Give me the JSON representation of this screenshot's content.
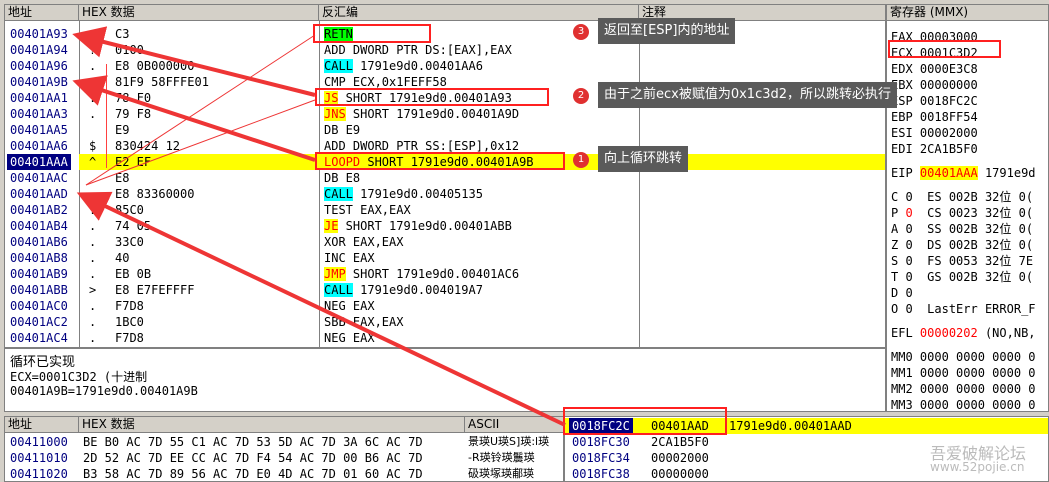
{
  "disasm": {
    "headers": {
      "addr": "地址",
      "hex": "HEX 数据",
      "asm": "反汇编",
      "comment": "注释"
    },
    "rows": [
      {
        "addr": "00401A93",
        "mark": ">",
        "hex": "C3",
        "asm": "RETN",
        "kw": "RETN",
        "kwstyle": "g",
        "rest": ""
      },
      {
        "addr": "00401A94",
        "mark": "?",
        "hex": "0100",
        "asm": "ADD DWORD PTR DS:[EAX],EAX",
        "kw": "",
        "kwstyle": "",
        "rest": ""
      },
      {
        "addr": "00401A96",
        "mark": ".",
        "hex": "E8 0B000000",
        "asm": "",
        "kw": "CALL",
        "kwstyle": "c",
        "rest": " 1791e9d0.00401AA6"
      },
      {
        "addr": "00401A9B",
        "mark": ".",
        "hex": "81F9 58FFFE01",
        "asm": "CMP ECX,0x1FEFF58",
        "kw": "",
        "kwstyle": "",
        "rest": ""
      },
      {
        "addr": "00401AA1",
        "mark": ".",
        "hex": "78 F0",
        "asm": "",
        "kw": "JS",
        "kwstyle": "y",
        "rest": " SHORT 1791e9d0.00401A93"
      },
      {
        "addr": "00401AA3",
        "mark": ".",
        "hex": "79 F8",
        "asm": "",
        "kw": "JNS",
        "kwstyle": "y",
        "rest": " SHORT 1791e9d0.00401A9D"
      },
      {
        "addr": "00401AA5",
        "mark": "",
        "hex": "E9",
        "asm": "DB E9",
        "kw": "",
        "kwstyle": "",
        "rest": ""
      },
      {
        "addr": "00401AA6",
        "mark": "$",
        "hex": "830424 12",
        "asm": "ADD DWORD PTR SS:[ESP],0x12",
        "kw": "",
        "kwstyle": "",
        "rest": ""
      },
      {
        "addr": "00401AAA",
        "mark": "^",
        "hex": "E2 EF",
        "asm": "",
        "kw": "LOOPD",
        "kwstyle": "y",
        "rest": " SHORT 1791e9d0.00401A9B"
      },
      {
        "addr": "00401AAC",
        "mark": "",
        "hex": "E8",
        "asm": "DB E8",
        "kw": "",
        "kwstyle": "",
        "rest": ""
      },
      {
        "addr": "00401AAD",
        "mark": ".",
        "hex": "E8 83360000",
        "asm": "",
        "kw": "CALL",
        "kwstyle": "c",
        "rest": " 1791e9d0.00405135"
      },
      {
        "addr": "00401AB2",
        "mark": ".",
        "hex": "85C0",
        "asm": "TEST EAX,EAX",
        "kw": "",
        "kwstyle": "",
        "rest": ""
      },
      {
        "addr": "00401AB4",
        "mark": ".",
        "hex": "74 05",
        "asm": "",
        "kw": "JE",
        "kwstyle": "y",
        "rest": " SHORT 1791e9d0.00401ABB"
      },
      {
        "addr": "00401AB6",
        "mark": ".",
        "hex": "33C0",
        "asm": "XOR EAX,EAX",
        "kw": "",
        "kwstyle": "",
        "rest": ""
      },
      {
        "addr": "00401AB8",
        "mark": ".",
        "hex": "40",
        "asm": "INC EAX",
        "kw": "",
        "kwstyle": "",
        "rest": ""
      },
      {
        "addr": "00401AB9",
        "mark": ".",
        "hex": "EB 0B",
        "asm": "",
        "kw": "JMP",
        "kwstyle": "y",
        "rest": " SHORT 1791e9d0.00401AC6"
      },
      {
        "addr": "00401ABB",
        "mark": ">",
        "hex": "E8 E7FEFFFF",
        "asm": "",
        "kw": "CALL",
        "kwstyle": "c",
        "rest": " 1791e9d0.004019A7"
      },
      {
        "addr": "00401AC0",
        "mark": ".",
        "hex": "F7D8",
        "asm": "NEG EAX",
        "kw": "",
        "kwstyle": "",
        "rest": ""
      },
      {
        "addr": "00401AC2",
        "mark": ".",
        "hex": "1BC0",
        "asm": "SBB EAX,EAX",
        "kw": "",
        "kwstyle": "",
        "rest": ""
      },
      {
        "addr": "00401AC4",
        "mark": ".",
        "hex": "F7D8",
        "asm": "NEG EAX",
        "kw": "",
        "kwstyle": "",
        "rest": ""
      }
    ]
  },
  "info": {
    "line1": "循环已实现",
    "line2": "ECX=0001C3D2 (十进制",
    "line3": "00401A9B=1791e9d0.00401A9B"
  },
  "registers": {
    "title": "寄存器 (MMX)",
    "gp": [
      {
        "name": "EAX",
        "val": "00003000"
      },
      {
        "name": "ECX",
        "val": "0001C3D2"
      },
      {
        "name": "EDX",
        "val": "0000E3C8"
      },
      {
        "name": "EBX",
        "val": "00000000"
      },
      {
        "name": "ESP",
        "val": "0018FC2C"
      },
      {
        "name": "EBP",
        "val": "0018FF54"
      },
      {
        "name": "ESI",
        "val": "00002000"
      },
      {
        "name": "EDI",
        "val": "2CA1B5F0"
      }
    ],
    "eip": {
      "name": "EIP",
      "val": "00401AAA",
      "rest": "1791e9d"
    },
    "flags": [
      {
        "f": "C",
        "v": "0",
        "seg": "ES 002B 32位 0("
      },
      {
        "f": "P",
        "v": "0",
        "seg": "CS 0023 32位 0("
      },
      {
        "f": "A",
        "v": "0",
        "seg": "SS 002B 32位 0("
      },
      {
        "f": "Z",
        "v": "0",
        "seg": "DS 002B 32位 0("
      },
      {
        "f": "S",
        "v": "0",
        "seg": "FS 0053 32位 7E"
      },
      {
        "f": "T",
        "v": "0",
        "seg": "GS 002B 32位 0("
      },
      {
        "f": "D",
        "v": "0",
        "seg": ""
      },
      {
        "f": "O",
        "v": "0",
        "seg": "LastErr ERROR_F"
      }
    ],
    "efl": {
      "name": "EFL",
      "val": "00000202",
      "rest": "(NO,NB,"
    },
    "mm": [
      {
        "name": "MM0",
        "val": "0000 0000 0000 0"
      },
      {
        "name": "MM1",
        "val": "0000 0000 0000 0"
      },
      {
        "name": "MM2",
        "val": "0000 0000 0000 0"
      },
      {
        "name": "MM3",
        "val": "0000 0000 0000 0"
      }
    ]
  },
  "dump": {
    "headers": {
      "addr": "地址",
      "hex": "HEX 数据",
      "ascii": "ASCII"
    },
    "rows": [
      {
        "addr": "00411000",
        "hex": "BE B0 AC 7D 55 C1 AC 7D 53 5D AC 7D 3A 6C AC 7D",
        "ascii": "景瑛U瑛S]瑛:l瑛"
      },
      {
        "addr": "00411010",
        "hex": "2D 52 AC 7D EE CC AC 7D F4 54 AC 7D 00 B6 AC 7D",
        "ascii": "-R瑛铃瑛鬞瑛"
      },
      {
        "addr": "00411020",
        "hex": "B3 58 AC 7D 89 56 AC 7D E0 4D AC 7D 01 60 AC 7D",
        "ascii": "砐瑛塚瑛郙瑛"
      }
    ]
  },
  "stack": {
    "rows": [
      {
        "addr": "0018FC2C",
        "val": "00401AAD",
        "comment": "1791e9d0.00401AAD"
      },
      {
        "addr": "0018FC30",
        "val": "2CA1B5F0",
        "comment": ""
      },
      {
        "addr": "0018FC34",
        "val": "00002000",
        "comment": ""
      },
      {
        "addr": "0018FC38",
        "val": "00000000",
        "comment": ""
      }
    ]
  },
  "callouts": [
    {
      "num": "3",
      "text": "返回至[ESP]内的地址"
    },
    {
      "num": "2",
      "text": "由于之前ecx被赋值为0x1c3d2，所以跳转必执行"
    },
    {
      "num": "1",
      "text": "向上循环跳转"
    }
  ],
  "watermark": {
    "line1": "吾爱破解论坛",
    "line2": "www.52pojie.cn"
  }
}
